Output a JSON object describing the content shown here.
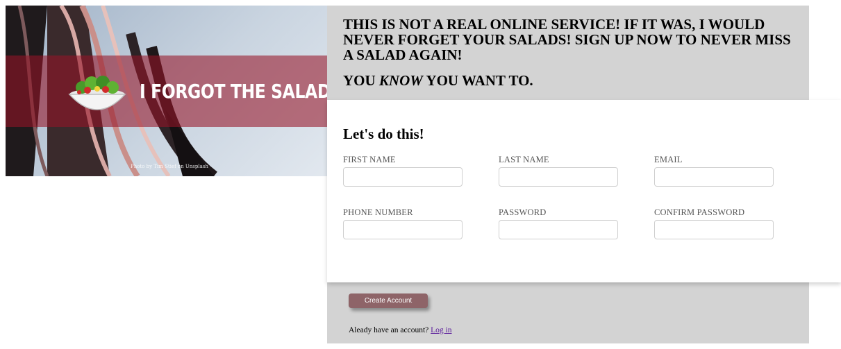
{
  "hero": {
    "title": "I FORGOT THE SALADS",
    "photo_credit": "Photo by Tim Stief on Unsplash",
    "icon": "salad-bowl-icon",
    "banner_color": "#961428"
  },
  "pitch": {
    "headline": "THIS IS NOT A REAL ONLINE SERVICE! IF IT WAS, I WOULD NEVER FORGET YOUR SALADS! SIGN UP NOW TO NEVER MISS A SALAD AGAIN!",
    "sub_before": "YOU ",
    "sub_emphasis": "KNOW",
    "sub_after": " YOU WANT TO."
  },
  "form": {
    "heading": "Let's do this!",
    "fields": [
      {
        "label": "FIRST NAME",
        "value": "",
        "placeholder": ""
      },
      {
        "label": "LAST NAME",
        "value": "",
        "placeholder": ""
      },
      {
        "label": "EMAIL",
        "value": "",
        "placeholder": ""
      },
      {
        "label": "PHONE NUMBER",
        "value": "",
        "placeholder": ""
      },
      {
        "label": "PASSWORD",
        "value": "",
        "placeholder": ""
      },
      {
        "label": "CONFIRM PASSWORD",
        "value": "",
        "placeholder": ""
      }
    ],
    "submit_label": "Create Account",
    "login_prompt": "Aleady have an account?",
    "login_link": "Log in"
  },
  "colors": {
    "panel_grey": "#d3d3d3",
    "button": "#8e6468",
    "link": "#5a1a9a"
  }
}
